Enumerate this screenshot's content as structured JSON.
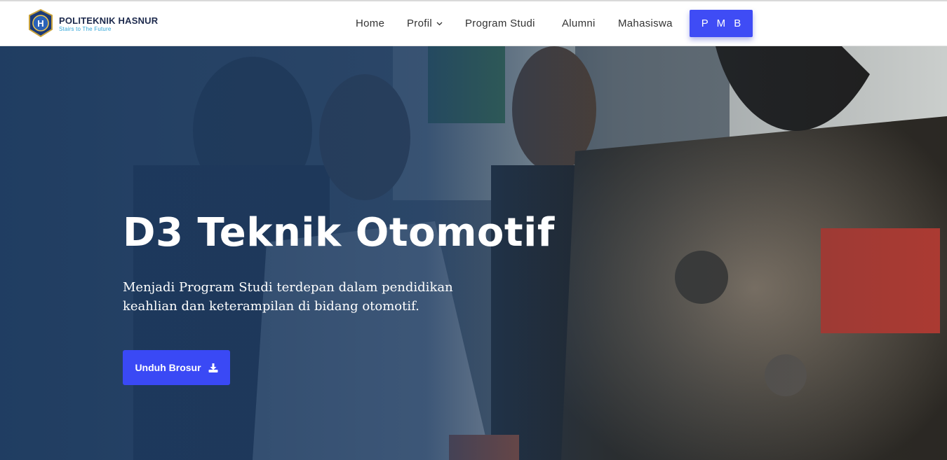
{
  "brand": {
    "name": "POLITEKNIK HASNUR",
    "tagline": "Stairs to The Future"
  },
  "nav": {
    "items": [
      "Home",
      "Profil",
      "Program Studi",
      "Alumni",
      "Mahasiswa"
    ],
    "cta": "P M B"
  },
  "hero": {
    "title": "D3 Teknik Otomotif",
    "description": "Menjadi Program Studi terdepan dalam pendidikan keahlian dan keterampilan di bidang otomotif.",
    "button_label": "Unduh Brosur"
  },
  "colors": {
    "accent": "#3f4cf5",
    "hero_overlay": "#1f3a5f"
  },
  "icons": {
    "dropdown": "chevron-down-icon",
    "download": "download-icon"
  }
}
